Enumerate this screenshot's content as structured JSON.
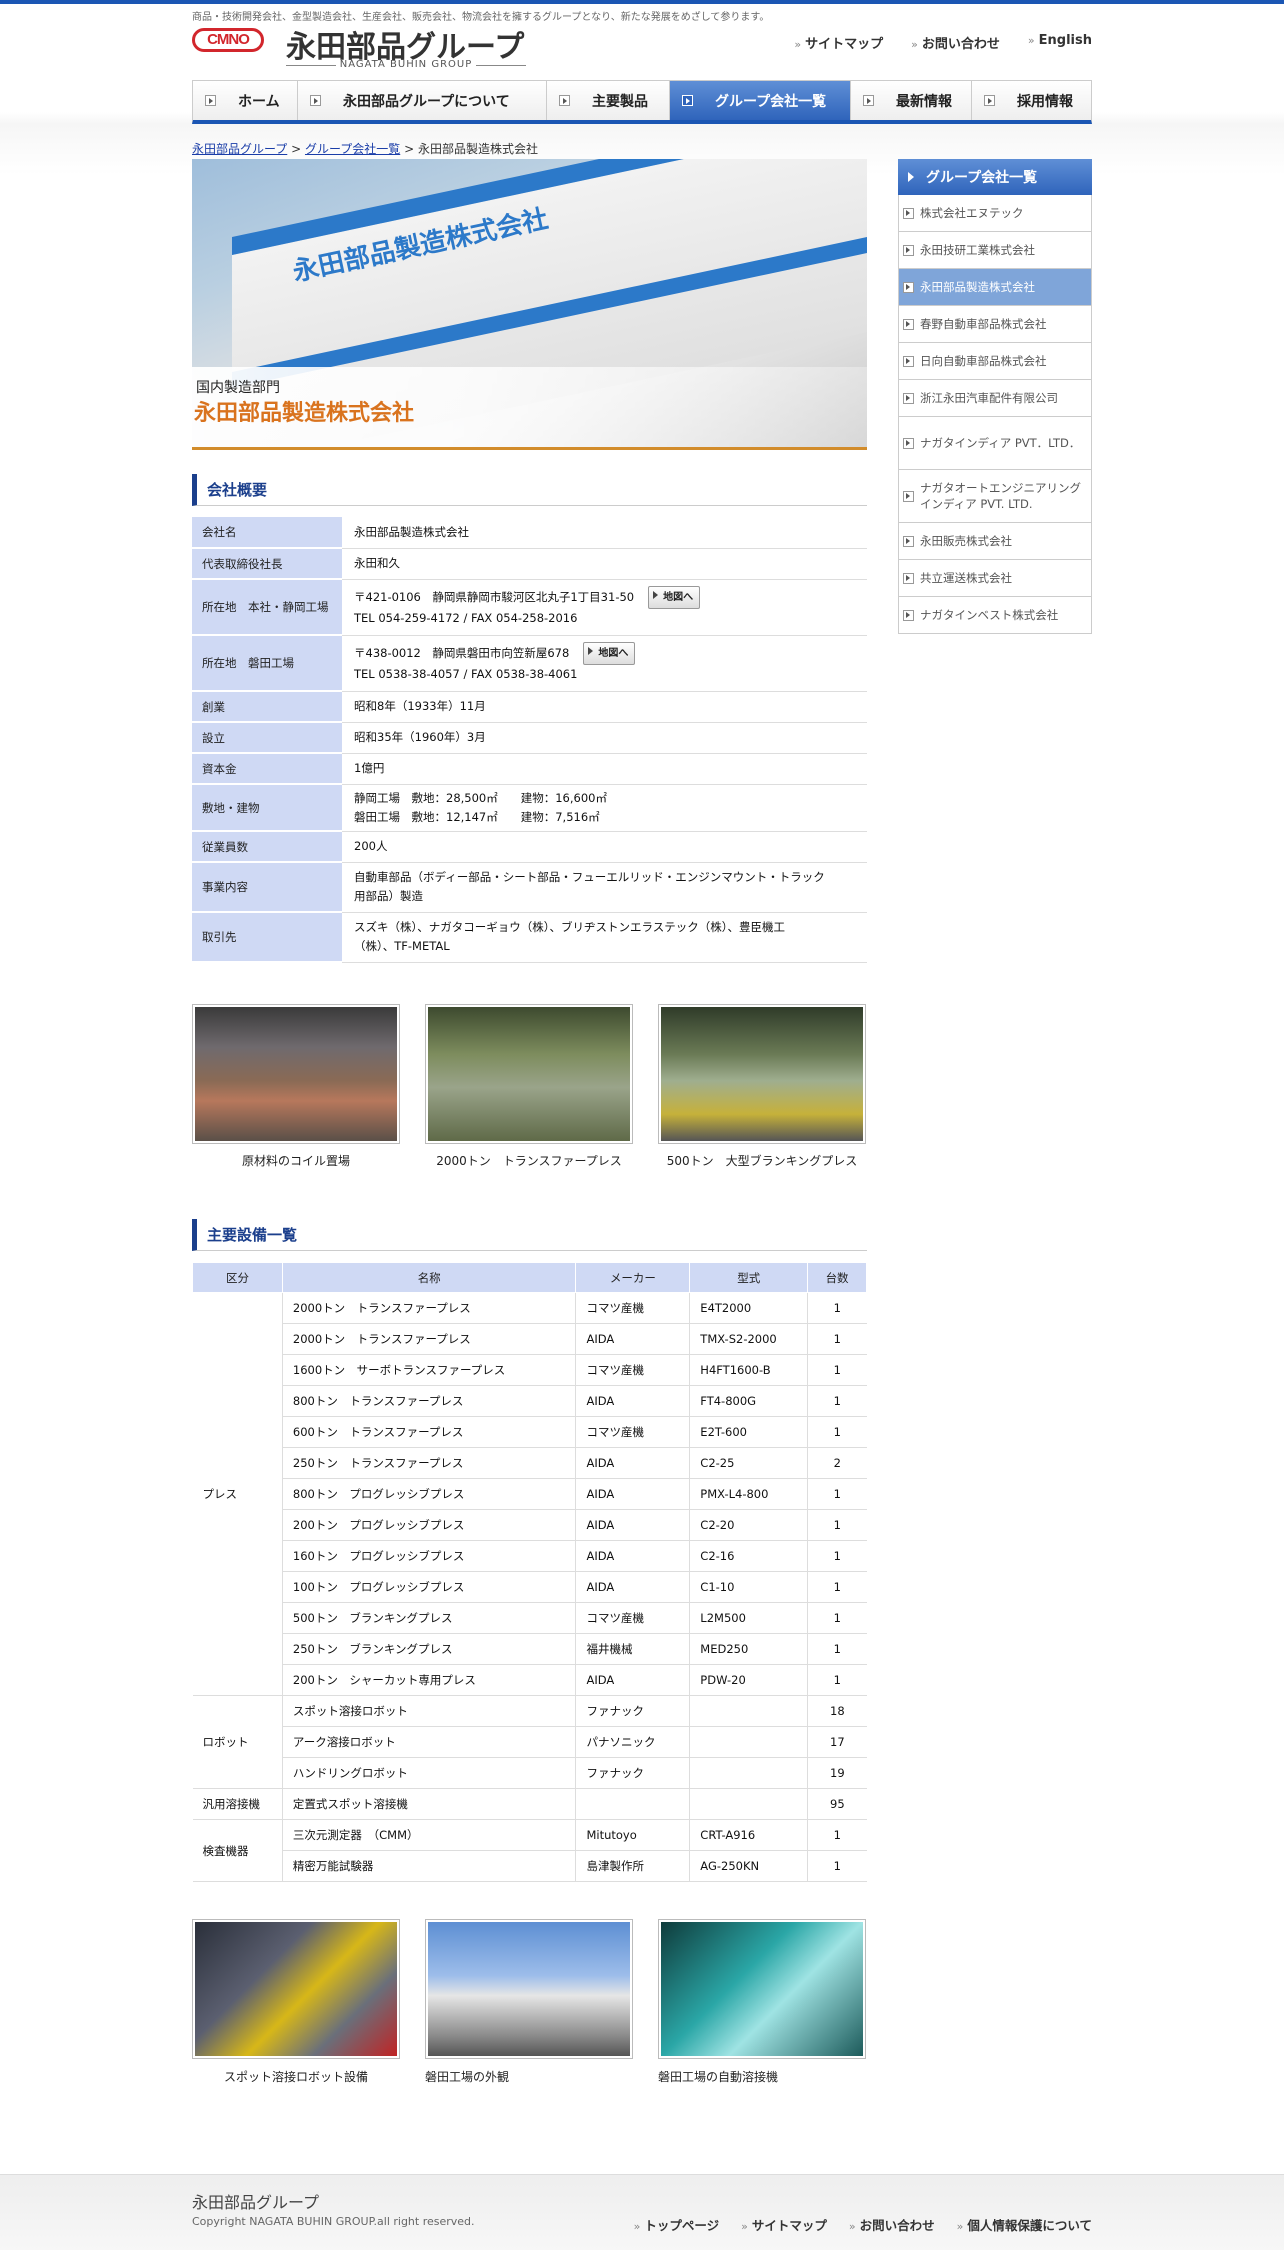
{
  "header": {
    "tagline": "商品・技術開発会社、金型製造会社、生産会社、販売会社、物流会社を擁するグループとなり、新たな発展をめざして参ります。",
    "logo_mark": "CMNO",
    "logo_title": "永田部品グループ",
    "logo_sub": "NAGATA BUHIN GROUP",
    "util": [
      "サイトマップ",
      "お問い合わせ",
      "English"
    ]
  },
  "nav": [
    "ホーム",
    "永田部品グループについて",
    "主要製品",
    "グループ会社一覧",
    "最新情報",
    "採用情報"
  ],
  "breadcrumb": {
    "home": "永田部品グループ",
    "list": "グループ会社一覧",
    "current": "永田部品製造株式会社"
  },
  "hero": {
    "sign": "永田部品製造株式会社",
    "dept": "国内製造部門",
    "company": "永田部品製造株式会社"
  },
  "overview": {
    "title": "会社概要",
    "map_label": "地図へ",
    "rows": [
      {
        "label": "会社名",
        "lines": [
          "永田部品製造株式会社"
        ]
      },
      {
        "label": "代表取締役社長",
        "lines": [
          "永田和久"
        ]
      },
      {
        "label": "所在地　本社・静岡工場",
        "lines": [
          "〒421-0106　静岡県静岡市駿河区北丸子1丁目31-50",
          "TEL 054-259-4172 / FAX 054-258-2016"
        ]
      },
      {
        "label": "所在地　磐田工場",
        "lines": [
          "〒438-0012　静岡県磐田市向笠新屋678",
          "TEL 0538-38-4057 / FAX 0538-38-4061"
        ]
      },
      {
        "label": "創業",
        "lines": [
          "昭和8年（1933年）11月"
        ]
      },
      {
        "label": "設立",
        "lines": [
          "昭和35年（1960年）3月"
        ]
      },
      {
        "label": "資本金",
        "lines": [
          "1億円"
        ]
      },
      {
        "label": "敷地・建物",
        "lines": [
          "静岡工場　敷地：28,500㎡　　建物：16,600㎡",
          "磐田工場　敷地：12,147㎡　　建物：7,516㎡"
        ]
      },
      {
        "label": "従業員数",
        "lines": [
          "200人"
        ]
      },
      {
        "label": "事業内容",
        "lines": [
          "自動車部品（ボディー部品・シート部品・フューエルリッド・エンジンマウント・トラック",
          "用部品）製造"
        ]
      },
      {
        "label": "取引先",
        "lines": [
          "スズキ（株）、ナガタコーギョウ（株）、ブリヂストンエラステック（株）、豊臣機工",
          "（株）、TF-METAL"
        ]
      }
    ]
  },
  "photos1": [
    "原材料のコイル置場",
    "2000トン　トランスファープレス",
    "500トン　大型ブランキングプレス"
  ],
  "equipment": {
    "title": "主要設備一覧",
    "headers": [
      "区分",
      "名称",
      "メーカー",
      "型式",
      "台数"
    ],
    "groups": [
      {
        "category": "プレス",
        "rows": [
          [
            "2000トン　トランスファープレス",
            "コマツ産機",
            "E4T2000",
            "1"
          ],
          [
            "2000トン　トランスファープレス",
            "AIDA",
            "TMX-S2-2000",
            "1"
          ],
          [
            "1600トン　サーボトランスファープレス",
            "コマツ産機",
            "H4FT1600-B",
            "1"
          ],
          [
            "800トン　トランスファープレス",
            "AIDA",
            "FT4-800G",
            "1"
          ],
          [
            "600トン　トランスファープレス",
            "コマツ産機",
            "E2T-600",
            "1"
          ],
          [
            "250トン　トランスファープレス",
            "AIDA",
            "C2-25",
            "2"
          ],
          [
            "800トン　プログレッシブプレス",
            "AIDA",
            "PMX-L4-800",
            "1"
          ],
          [
            "200トン　プログレッシブプレス",
            "AIDA",
            "C2-20",
            "1"
          ],
          [
            "160トン　プログレッシブプレス",
            "AIDA",
            "C2-16",
            "1"
          ],
          [
            "100トン　プログレッシブプレス",
            "AIDA",
            "C1-10",
            "1"
          ],
          [
            "500トン　ブランキングプレス",
            "コマツ産機",
            "L2M500",
            "1"
          ],
          [
            "250トン　ブランキングプレス",
            "福井機械",
            "MED250",
            "1"
          ],
          [
            "200トン　シャーカット専用プレス",
            "AIDA",
            "PDW-20",
            "1"
          ]
        ]
      },
      {
        "category": "ロボット",
        "rows": [
          [
            "スポット溶接ロボット",
            "ファナック",
            "",
            "18"
          ],
          [
            "アーク溶接ロボット",
            "パナソニック",
            "",
            "17"
          ],
          [
            "ハンドリングロボット",
            "ファナック",
            "",
            "19"
          ]
        ]
      },
      {
        "category": "汎用溶接機",
        "rows": [
          [
            "定置式スポット溶接機",
            "",
            "",
            "95"
          ]
        ]
      },
      {
        "category": "検査機器",
        "rows": [
          [
            "三次元測定器　（CMM）",
            "Mitutoyo",
            "CRT-A916",
            "1"
          ],
          [
            "精密万能試験器",
            "島津製作所",
            "AG-250KN",
            "1"
          ]
        ]
      }
    ]
  },
  "photos2": [
    "スポット溶接ロボット設備",
    "磐田工場の外観",
    "磐田工場の自動溶接機"
  ],
  "sidebar": {
    "title": "グループ会社一覧",
    "items": [
      "株式会社エヌテック",
      "永田技研工業株式会社",
      "永田部品製造株式会社",
      "春野自動車部品株式会社",
      "日向自動車部品株式会社",
      "浙江永田汽車配件有限公司",
      "ナガタインディア PVT．LTD．",
      "ナガタオートエンジニアリングインディア PVT. LTD.",
      "永田販売株式会社",
      "共立運送株式会社",
      "ナガタインベスト株式会社"
    ]
  },
  "footer": {
    "name": "永田部品グループ",
    "copyright": "Copyright NAGATA BUHIN GROUP.all right reserved.",
    "links": [
      "トップページ",
      "サイトマップ",
      "お問い合わせ",
      "個人情報保護について"
    ]
  },
  "colors": {
    "accent": "#1b56b4",
    "heading": "#1b3f8c",
    "th_bg": "#cfd9f4",
    "company_orange": "#d9731e"
  }
}
